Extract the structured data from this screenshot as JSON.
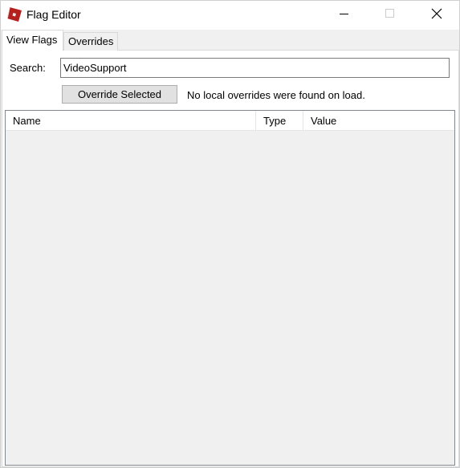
{
  "window": {
    "title": "Flag Editor",
    "icon": "roblox-studio-icon",
    "controls": [
      "minimize-icon",
      "maximize-icon",
      "close-icon"
    ]
  },
  "tabs": [
    {
      "label": "View Flags",
      "active": true
    },
    {
      "label": "Overrides",
      "active": false
    }
  ],
  "search": {
    "label": "Search:",
    "value": "VideoSupport",
    "placeholder": ""
  },
  "actions": {
    "override_label": "Override Selected",
    "status": "No local overrides were found on load."
  },
  "list": {
    "columns": [
      "Name",
      "Type",
      "Value"
    ],
    "rows": []
  },
  "colors": {
    "icon_red": "#b3201e",
    "window_bg": "#f0f0f0",
    "panel_bg": "#ffffff",
    "button_bg": "#e1e1e1"
  }
}
